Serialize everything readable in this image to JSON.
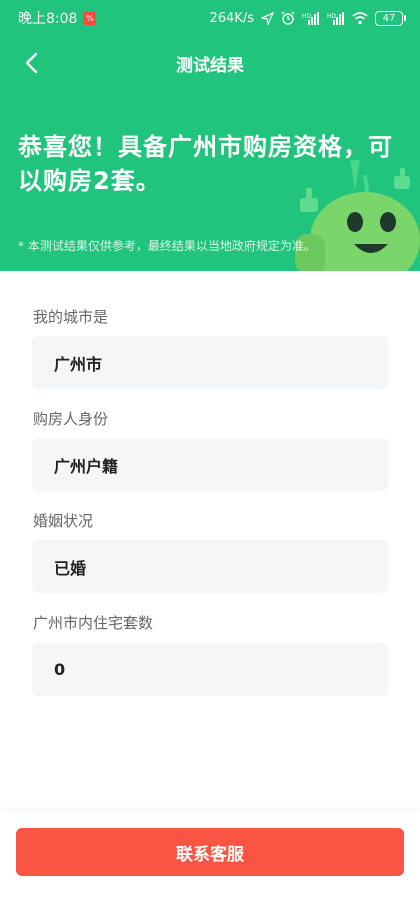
{
  "status_bar": {
    "time": "晚上8:08",
    "network_speed": "264K/s",
    "battery_level": "47",
    "icons": [
      "notification-icon",
      "location-icon",
      "alarm-icon",
      "signal-hd-icon",
      "signal-hd-icon",
      "wifi-icon",
      "battery-icon"
    ]
  },
  "nav": {
    "title": "测试结果",
    "back_icon": "chevron-left-icon"
  },
  "result": {
    "headline": "恭喜您！具备广州市购房资格，可以购房2套。",
    "disclaimer": "* 本测试结果仅供参考，最终结果以当地政府规定为准。"
  },
  "form": {
    "city_label": "我的城市是",
    "city_value": "广州市",
    "identity_label": "购房人身份",
    "identity_value": "广州户籍",
    "marital_label": "婚姻状况",
    "marital_value": "已婚",
    "houses_label": "广州市内住宅套数",
    "houses_value": "0"
  },
  "footer": {
    "contact_label": "联系客服"
  },
  "colors": {
    "header_green": "#21c47c",
    "button_red": "#fa5544",
    "field_bg": "#f5f6f8"
  }
}
